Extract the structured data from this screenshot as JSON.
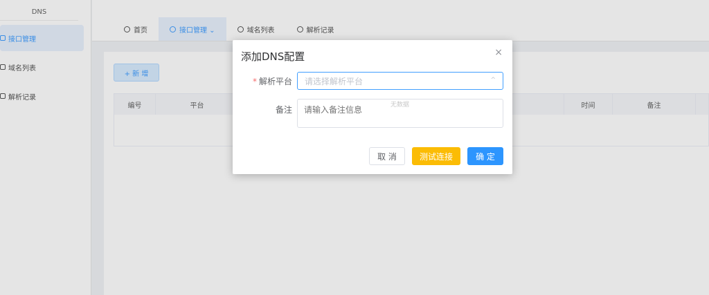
{
  "sidebar": {
    "logo_text": "DNS",
    "items": [
      {
        "label": "接口管理",
        "active": true
      },
      {
        "label": "域名列表",
        "active": false
      },
      {
        "label": "解析记录",
        "active": false
      }
    ]
  },
  "tabs": [
    {
      "label": "首页",
      "active": false
    },
    {
      "label": "接口管理 ⌄",
      "active": true
    },
    {
      "label": "域名列表",
      "active": false
    },
    {
      "label": "解析记录",
      "active": false
    }
  ],
  "content": {
    "add_button": "+ 新 增",
    "table": {
      "headers": [
        "编号",
        "平台",
        "时间",
        "备注"
      ]
    }
  },
  "dialog": {
    "title": "添加DNS配置",
    "close_icon": "×",
    "platform": {
      "label": "解析平台",
      "required_mark": "*",
      "placeholder": "请选择解析平台",
      "arrow": "^"
    },
    "remark": {
      "label": "备注",
      "placeholder": "请输入备注信息",
      "ghost_text": "无数据"
    },
    "buttons": {
      "cancel": "取 消",
      "test": "测试连接",
      "confirm": "确 定"
    }
  },
  "colors": {
    "primary": "#2d95fe",
    "warning": "#fbbc05",
    "required": "#f56c6c"
  }
}
